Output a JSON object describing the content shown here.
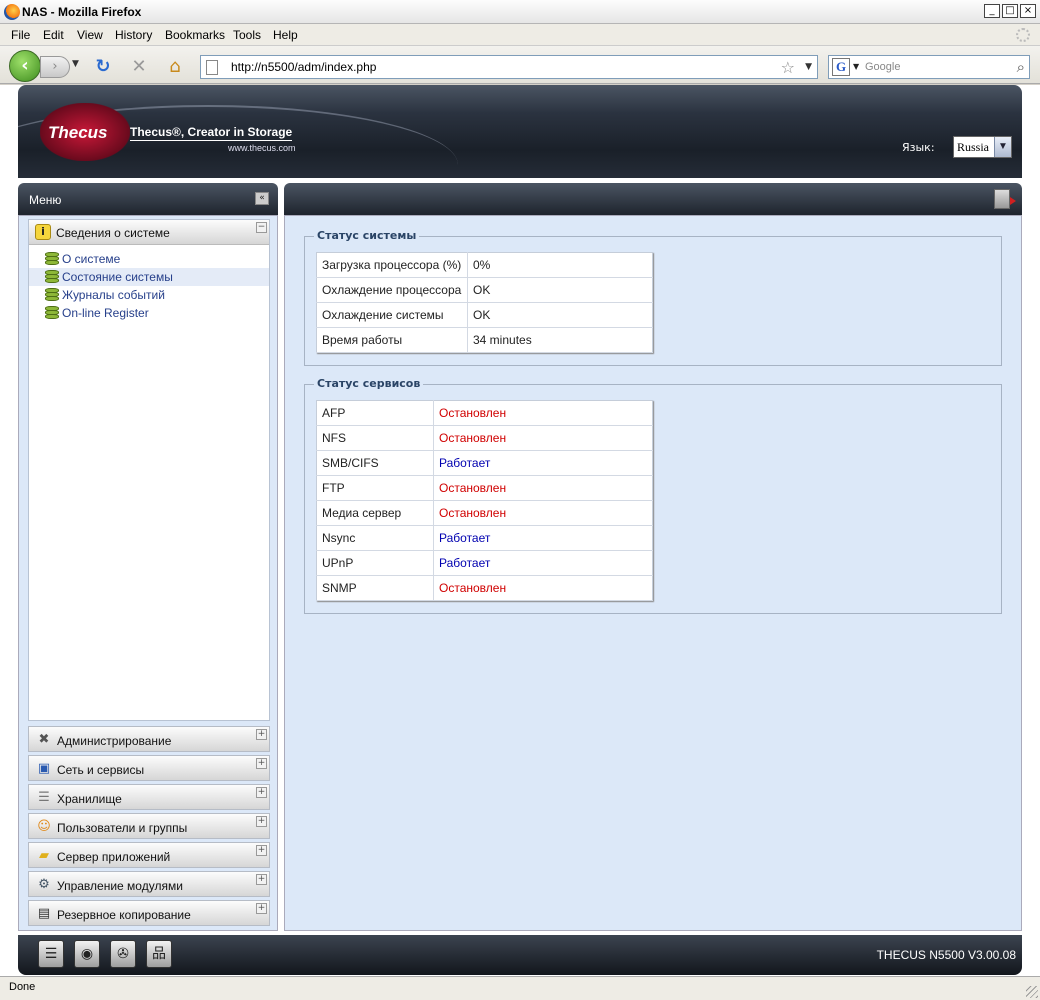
{
  "window": {
    "title": "NAS - Mozilla Firefox",
    "controls": [
      "_",
      "□",
      "×"
    ]
  },
  "menu": [
    "File",
    "Edit",
    "View",
    "History",
    "Bookmarks",
    "Tools",
    "Help"
  ],
  "toolbar": {
    "url": "http://n5500/adm/index.php",
    "search_placeholder": "Google",
    "search_engine_letter": "G"
  },
  "header": {
    "logo": "Thecus",
    "slogan": "Thecus®, Creator in Storage",
    "site": "www.thecus.com",
    "lang_label": "Язык:",
    "lang_value": "Russia"
  },
  "sidebar": {
    "title": "Меню",
    "collapse_label": "«",
    "section": {
      "label": "Сведения о системе",
      "items": [
        {
          "label": "О системе",
          "active": false
        },
        {
          "label": "Состояние системы",
          "active": true
        },
        {
          "label": "Журналы событий",
          "active": false
        },
        {
          "label": "On-line Register",
          "active": false
        }
      ]
    },
    "groups": [
      {
        "label": "Администрирование",
        "icon": "tools-icon"
      },
      {
        "label": "Сеть и сервисы",
        "icon": "network-icon"
      },
      {
        "label": "Хранилище",
        "icon": "storage-icon"
      },
      {
        "label": "Пользователи и группы",
        "icon": "users-icon"
      },
      {
        "label": "Сервер приложений",
        "icon": "folder-icon"
      },
      {
        "label": "Управление модулями",
        "icon": "gears-icon"
      },
      {
        "label": "Резервное копирование",
        "icon": "backup-icon"
      }
    ]
  },
  "system_status": {
    "legend": "Статус системы",
    "rows": [
      {
        "key": "Загрузка процессора (%)",
        "value": "0%"
      },
      {
        "key": "Охлаждение процессора",
        "value": "OK"
      },
      {
        "key": "Охлаждение системы",
        "value": "OK"
      },
      {
        "key": "Время работы",
        "value": "34 minutes"
      }
    ]
  },
  "service_status": {
    "legend": "Статус сервисов",
    "rows": [
      {
        "key": "AFP",
        "value": "Остановлен",
        "state": "stopped"
      },
      {
        "key": "NFS",
        "value": "Остановлен",
        "state": "stopped"
      },
      {
        "key": "SMB/CIFS",
        "value": "Работает",
        "state": "running"
      },
      {
        "key": "FTP",
        "value": "Остановлен",
        "state": "stopped"
      },
      {
        "key": "Медиа сервер",
        "value": "Остановлен",
        "state": "stopped"
      },
      {
        "key": "Nsync",
        "value": "Работает",
        "state": "running"
      },
      {
        "key": "UPnP",
        "value": "Работает",
        "state": "running"
      },
      {
        "key": "SNMP",
        "value": "Остановлен",
        "state": "stopped"
      }
    ]
  },
  "footer": {
    "version": "THECUS N5500 V3.00.08",
    "icons": [
      "server-icon",
      "disk-icon",
      "fan-icon",
      "network-tree-icon"
    ]
  },
  "statusbar": {
    "text": "Done"
  },
  "colors": {
    "stopped": "#d00000",
    "running": "#0000b0",
    "panel_bg": "#dce8f8"
  }
}
